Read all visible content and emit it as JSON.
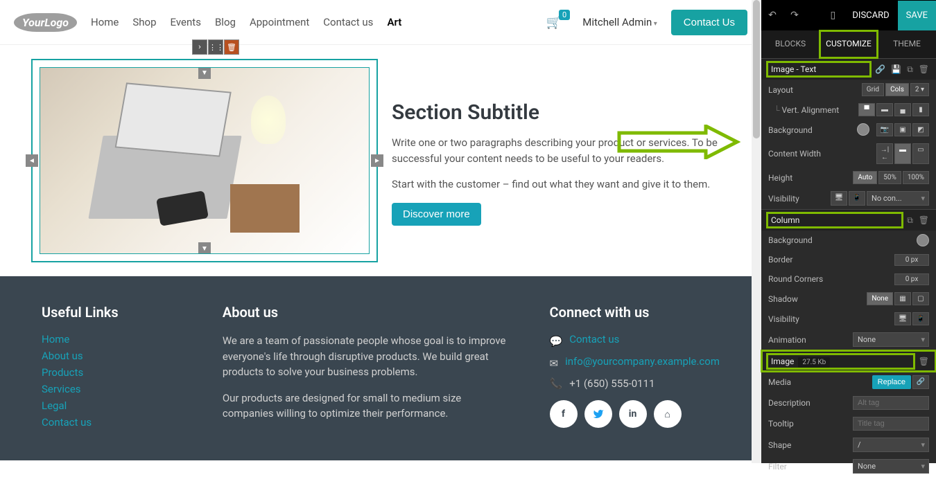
{
  "header": {
    "logo": "YourLogo",
    "nav": [
      "Home",
      "Shop",
      "Events",
      "Blog",
      "Appointment",
      "Contact us",
      "Art"
    ],
    "nav_active": "Art",
    "cart_count": "0",
    "user": "Mitchell Admin",
    "contact_btn": "Contact Us"
  },
  "section": {
    "subtitle": "Section Subtitle",
    "para1": "Write one or two paragraphs describing your product or services. To be successful your content needs to be useful to your readers.",
    "para2": "Start with the customer – find out what they want and give it to them.",
    "discover": "Discover more"
  },
  "footer": {
    "useful": {
      "title": "Useful Links",
      "links": [
        "Home",
        "About us",
        "Products",
        "Services",
        "Legal",
        "Contact us"
      ]
    },
    "about": {
      "title": "About us",
      "p1": "We are a team of passionate people whose goal is to improve everyone's life through disruptive products. We build great products to solve your business problems.",
      "p2": "Our products are designed for small to medium size companies willing to optimize their performance."
    },
    "connect": {
      "title": "Connect with us",
      "contact_link": "Contact us",
      "email": "info@yourcompany.example.com",
      "phone": "+1 (650) 555-0111"
    }
  },
  "panel": {
    "top": {
      "discard": "DISCARD",
      "save": "SAVE"
    },
    "tabs": {
      "blocks": "BLOCKS",
      "customize": "CUSTOMIZE",
      "theme": "THEME"
    },
    "s1": {
      "title": "Image - Text",
      "layout": "Layout",
      "grid": "Grid",
      "cols": "Cols",
      "cols_val": "2",
      "valign": "Vert. Alignment",
      "bg": "Background",
      "cw": "Content Width",
      "height": "Height",
      "auto": "Auto",
      "fifty": "50%",
      "hundred": "100%",
      "vis": "Visibility",
      "nocon": "No con..."
    },
    "s2": {
      "title": "Column",
      "bg": "Background",
      "border": "Border",
      "border_val": "0 px",
      "round": "Round Corners",
      "round_val": "0 px",
      "shadow": "Shadow",
      "shadow_val": "None",
      "vis": "Visibility",
      "anim": "Animation",
      "anim_val": "None"
    },
    "s3": {
      "title": "Image",
      "size": "27.5 Kb",
      "media": "Media",
      "replace": "Replace",
      "desc": "Description",
      "desc_ph": "Alt tag",
      "tooltip": "Tooltip",
      "tooltip_ph": "Title tag",
      "shape": "Shape",
      "shape_val": "/",
      "filter": "Filter",
      "filter_val": "None"
    }
  }
}
